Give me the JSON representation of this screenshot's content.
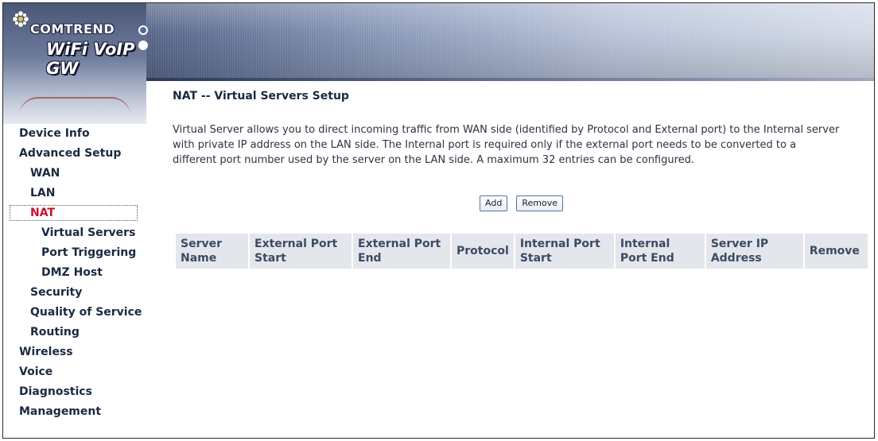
{
  "brand": {
    "company": "COMTREND",
    "product": "WiFi VoIP GW",
    "colors": {
      "banner_dark": "#3d4b6a",
      "banner_light": "#d4dbe8",
      "nav_text": "#1a2a40",
      "active_nav": "#c8102e",
      "table_header_bg": "#e3e6eb"
    }
  },
  "sidebar": {
    "items": [
      {
        "label": "Device Info"
      },
      {
        "label": "Advanced Setup"
      },
      {
        "label": "WAN"
      },
      {
        "label": "LAN"
      },
      {
        "label": "NAT"
      },
      {
        "label": "Virtual Servers"
      },
      {
        "label": "Port Triggering"
      },
      {
        "label": "DMZ Host"
      },
      {
        "label": "Security"
      },
      {
        "label": "Quality of Service"
      },
      {
        "label": "Routing"
      },
      {
        "label": "Wireless"
      },
      {
        "label": "Voice"
      },
      {
        "label": "Diagnostics"
      },
      {
        "label": "Management"
      }
    ],
    "active": "NAT"
  },
  "main": {
    "title": "NAT -- Virtual Servers Setup",
    "description": "Virtual Server allows you to direct incoming traffic from WAN side (identified by Protocol and External port) to the Internal server with private IP address on the LAN side. The Internal port is required only if the external port needs to be converted to a different port number used by the server on the LAN side. A maximum 32 entries can be configured.",
    "buttons": {
      "add": "Add",
      "remove": "Remove"
    },
    "table": {
      "headers": [
        "Server Name",
        "External Port Start",
        "External Port End",
        "Protocol",
        "Internal Port Start",
        "Internal Port End",
        "Server IP Address",
        "Remove"
      ],
      "rows": []
    }
  }
}
